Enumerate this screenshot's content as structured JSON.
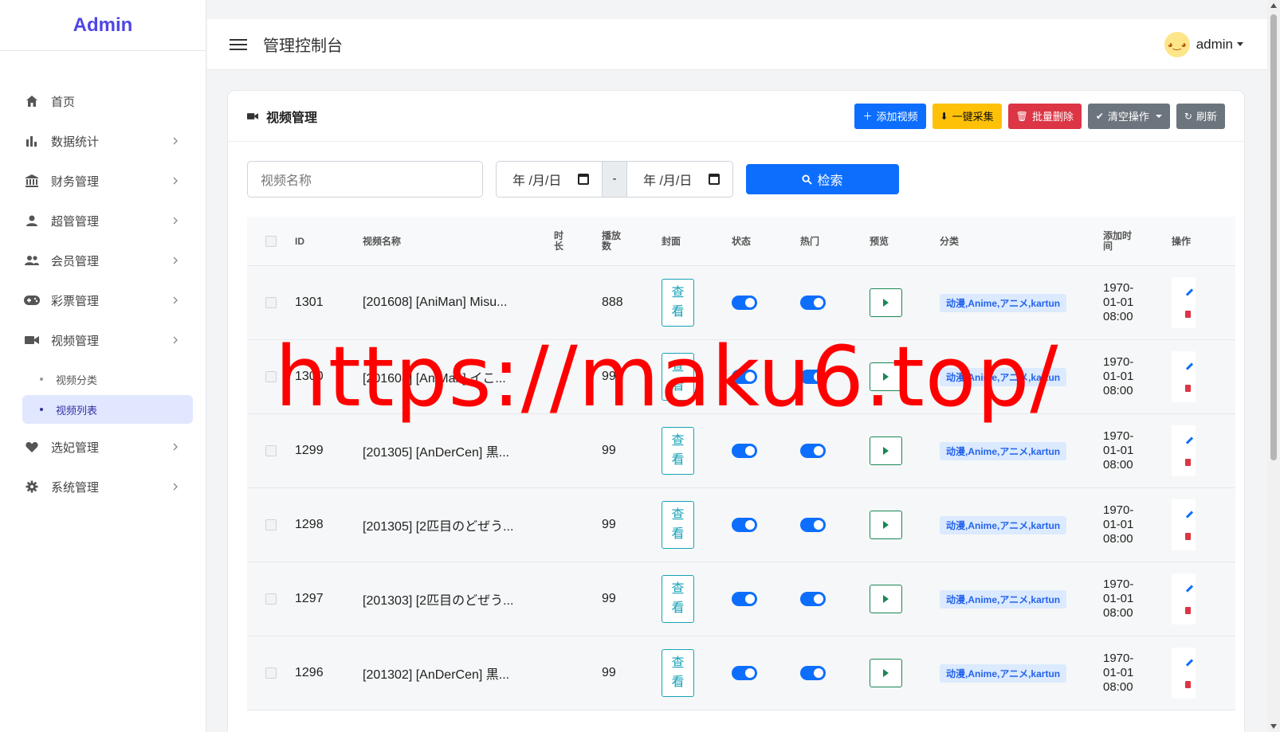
{
  "brand": "Admin",
  "header": {
    "title": "管理控制台",
    "user": "admin"
  },
  "sidebar": {
    "items": [
      {
        "label": "首页",
        "icon": "home-icon",
        "has_children": false
      },
      {
        "label": "数据统计",
        "icon": "bar-chart-icon",
        "has_children": true
      },
      {
        "label": "财务管理",
        "icon": "bank-icon",
        "has_children": true
      },
      {
        "label": "超管管理",
        "icon": "user-icon",
        "has_children": true
      },
      {
        "label": "会员管理",
        "icon": "users-icon",
        "has_children": true
      },
      {
        "label": "彩票管理",
        "icon": "gamepad-icon",
        "has_children": true
      },
      {
        "label": "视频管理",
        "icon": "video-icon",
        "has_children": true
      },
      {
        "label": "选妃管理",
        "icon": "heart-icon",
        "has_children": true
      },
      {
        "label": "系统管理",
        "icon": "gear-icon",
        "has_children": true
      }
    ],
    "video_sub": [
      {
        "label": "视频分类",
        "active": false
      },
      {
        "label": "视频列表",
        "active": true
      }
    ]
  },
  "card": {
    "title": "视频管理",
    "buttons": {
      "add": "添加视频",
      "collect": "一键采集",
      "batch_delete": "批量删除",
      "clear": "清空操作",
      "refresh": "刷新"
    }
  },
  "filters": {
    "name_placeholder": "视频名称",
    "date_start": "年 /月/日",
    "date_sep": "-",
    "date_end": "年 /月/日",
    "search": "检索"
  },
  "table": {
    "columns": {
      "id": "ID",
      "name": "视频名称",
      "duration": "时长",
      "plays": "播放数",
      "cover": "封面",
      "status": "状态",
      "hot": "热门",
      "preview": "预览",
      "category": "分类",
      "added": "添加时间",
      "ops": "操作"
    },
    "cover_label_1": "查",
    "cover_label_2": "看",
    "rows": [
      {
        "id": "1301",
        "name": "[201608] [AniMan] Misu...",
        "duration": "",
        "plays": "888",
        "category": "动漫,Anime,アニメ,kartun",
        "date": "1970-",
        "date2": "01-01",
        "time": "08:00",
        "status": true,
        "hot": true
      },
      {
        "id": "1300",
        "name": "[201608] [AniMan] イこ...",
        "duration": "",
        "plays": "99",
        "category": "动漫,Anime,アニメ,kartun",
        "date": "1970-",
        "date2": "01-01",
        "time": "08:00",
        "status": true,
        "hot": true
      },
      {
        "id": "1299",
        "name": "[201305] [AnDerCen] 黒...",
        "duration": "",
        "plays": "99",
        "category": "动漫,Anime,アニメ,kartun",
        "date": "1970-",
        "date2": "01-01",
        "time": "08:00",
        "status": true,
        "hot": true
      },
      {
        "id": "1298",
        "name": "[201305] [2匹目のどぜう...",
        "duration": "",
        "plays": "99",
        "category": "动漫,Anime,アニメ,kartun",
        "date": "1970-",
        "date2": "01-01",
        "time": "08:00",
        "status": true,
        "hot": true
      },
      {
        "id": "1297",
        "name": "[201303] [2匹目のどぜう...",
        "duration": "",
        "plays": "99",
        "category": "动漫,Anime,アニメ,kartun",
        "date": "1970-",
        "date2": "01-01",
        "time": "08:00",
        "status": true,
        "hot": true
      },
      {
        "id": "1296",
        "name": "[201302] [AnDerCen] 黒...",
        "duration": "",
        "plays": "99",
        "category": "动漫,Anime,アニメ,kartun",
        "date": "1970-",
        "date2": "01-01",
        "time": "08:00",
        "status": true,
        "hot": true
      }
    ]
  },
  "watermark": "https://maku6.top/",
  "colors": {
    "brand": "#4f46e5",
    "primary": "#0d6efd",
    "warning": "#ffc107",
    "danger": "#dc3545",
    "secondary": "#6c757d",
    "watermark": "#ff0000"
  }
}
